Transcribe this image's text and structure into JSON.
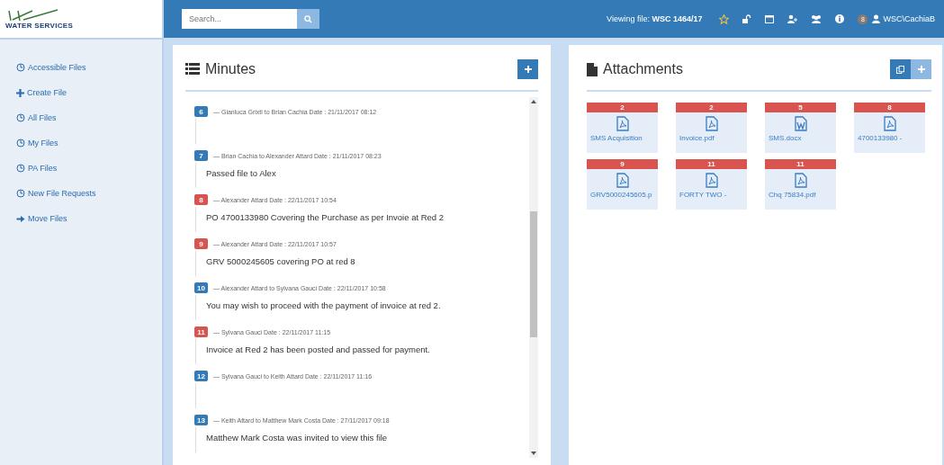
{
  "logo": {
    "text": "WATER SERVICES"
  },
  "sidebar": {
    "items": [
      {
        "label": "Accessible Files",
        "kind": "clock"
      },
      {
        "label": "Create File",
        "kind": "plus"
      },
      {
        "label": "All Files",
        "kind": "clock"
      },
      {
        "label": "My Files",
        "kind": "clock"
      },
      {
        "label": "PA Files",
        "kind": "clock"
      },
      {
        "label": "New File Requests",
        "kind": "clock"
      },
      {
        "label": "Move Files",
        "kind": "arrow"
      }
    ]
  },
  "topbar": {
    "search": {
      "placeholder": "Search..."
    },
    "viewing": "Viewing file: **WSC 1464/17**",
    "notifications": "8",
    "user": "WSC\\CachiaB"
  },
  "minutes": {
    "title": "Minutes",
    "entries": [
      {
        "badge": "6",
        "color": "#337ab7",
        "header": "— Gianluca Grixti to Brian Cachia Date : 21/11/2017 08:12"
      },
      {
        "badge": "7",
        "color": "#337ab7",
        "header": "— Brian Cachia to Alexander Attard Date : 21/11/2017 08:23",
        "body": "Passed file to Alex"
      },
      {
        "badge": "8",
        "color": "#d9534f",
        "header": "— Alexander Attard Date : 22/11/2017 10:54",
        "body": "PO 4700133980 Covering the Purchase as per Invoie at Red 2"
      },
      {
        "badge": "9",
        "color": "#d9534f",
        "header": "— Alexander Attard Date : 22/11/2017 10:57",
        "body": "GRV 5000245605 covering PO at red 8"
      },
      {
        "badge": "10",
        "color": "#337ab7",
        "header": "— Alexander Attard to Sylvana Gauci Date : 22/11/2017 10:58",
        "body": "You may wish to proceed with the payment of invoice at red 2."
      },
      {
        "badge": "11",
        "color": "#d9534f",
        "header": "— Sylvana Gauci Date : 22/11/2017 11:15",
        "body": "Invoice at Red 2 has been posted and passed for payment."
      },
      {
        "badge": "12",
        "color": "#337ab7",
        "header": "— Sylvana Gauci to Keith Attard Date : 22/11/2017 11:16"
      },
      {
        "badge": "13",
        "color": "#337ab7",
        "header": "— Keith Attard to Matthew Mark Costa Date : 27/11/2017 09:18",
        "body": "Matthew Mark Costa was invited to view this file"
      }
    ]
  },
  "attachments": {
    "title": "Attachments",
    "files": [
      {
        "badge": "2",
        "kind": "pdf",
        "name": "SMS Acquisition"
      },
      {
        "badge": "2",
        "kind": "pdf",
        "name": "Invoice.pdf"
      },
      {
        "badge": "5",
        "kind": "word",
        "name": "SMS.docx"
      },
      {
        "badge": "8",
        "kind": "pdf",
        "name": "4700133980 -"
      },
      {
        "badge": "9",
        "kind": "pdf",
        "name": "GRV5000245605.p"
      },
      {
        "badge": "11",
        "kind": "pdf",
        "name": "FORTY TWO -"
      },
      {
        "badge": "11",
        "kind": "pdf",
        "name": "Chq 75834.pdf"
      }
    ]
  }
}
